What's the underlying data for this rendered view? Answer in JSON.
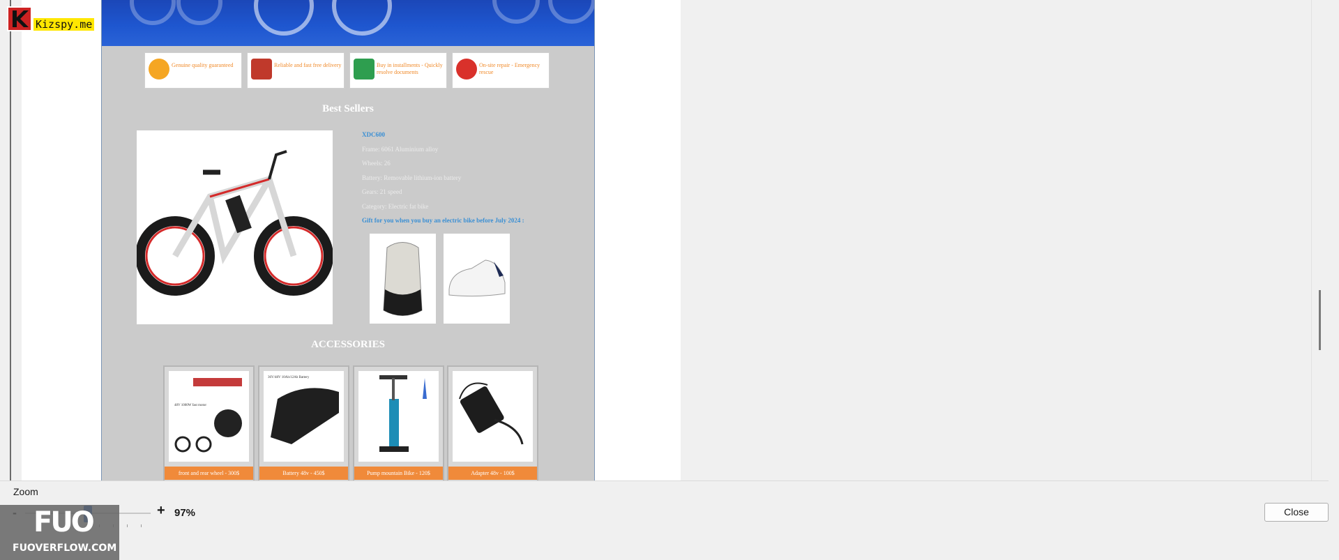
{
  "watermark_top": {
    "brand": "Kizspy.me"
  },
  "watermark_bottom": {
    "logo": "FUO",
    "site": "FUOVERFLOW.COM"
  },
  "preview": {
    "features": [
      {
        "icon": "award-badge-icon",
        "text": "Genuine quality guaranteed",
        "color": "#f5a623"
      },
      {
        "icon": "delivery-person-icon",
        "text": "Reliable and fast free delivery",
        "color": "#c0392b"
      },
      {
        "icon": "money-bag-icon",
        "text": "Buy in installments - Quickly resolve documents",
        "color": "#2e9e4f"
      },
      {
        "icon": "repair-gear-icon",
        "text": "On-site repair - Emergency rescue",
        "color": "#d9312b"
      }
    ],
    "best_sellers_title": "Best Sellers",
    "product": {
      "name": "XDC600",
      "specs": [
        "Frame: 6061 Aluminium alloy",
        "Wheels: 26",
        "Battery: Removable lithium-ion battery",
        "Gears: 21 speed",
        "Category: Electric fat bike"
      ],
      "gift_text": "Gift for you when you buy an electric bike before July 2024 :",
      "gift_items": [
        "backpack-image",
        "sneaker-image"
      ]
    },
    "accessories_title": "ACCESSORIES",
    "accessories": [
      {
        "label": "front and rear wheel - 300$",
        "image_caption": "48V 1000W fast motor"
      },
      {
        "label": "Battery 48v - 450$",
        "image_caption": "36V/48V 10Ah/12Ah Battery"
      },
      {
        "label": "Pump mountain Bike - 120$",
        "image_caption": ""
      },
      {
        "label": "Adapter 48v - 100$",
        "image_caption": ""
      }
    ]
  },
  "zoom": {
    "label": "Zoom",
    "minus": "-",
    "plus": "+",
    "value": "97%",
    "level_percent": 97
  },
  "buttons": {
    "close": "Close"
  },
  "colors": {
    "accent": "#1e5fc6",
    "hero": "#1e56cf",
    "orange": "#f08a3a",
    "product_blue": "#3a8fd4"
  }
}
